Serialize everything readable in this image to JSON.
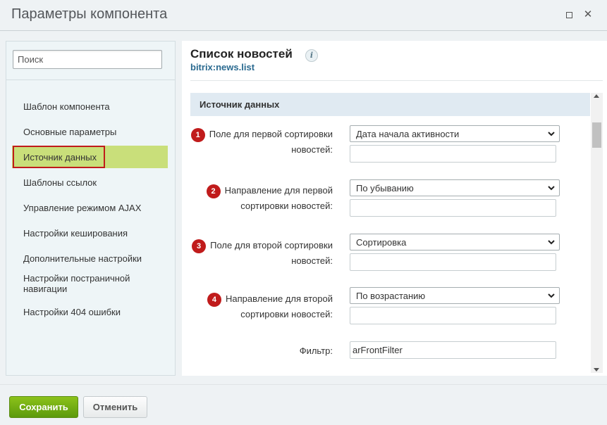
{
  "window": {
    "title": "Параметры компонента"
  },
  "sidebar": {
    "search_placeholder": "Поиск",
    "items": [
      {
        "label": "Шаблон компонента"
      },
      {
        "label": "Основные параметры"
      },
      {
        "label": "Источник данных",
        "active": true
      },
      {
        "label": "Шаблоны ссылок"
      },
      {
        "label": "Управление режимом AJAX"
      },
      {
        "label": "Настройки кеширования"
      },
      {
        "label": "Дополнительные настройки"
      },
      {
        "label": "Настройки постраничной навигации"
      },
      {
        "label": "Настройки 404 ошибки"
      }
    ]
  },
  "component": {
    "title": "Список новостей",
    "code": "bitrix:news.list",
    "info_icon": "i"
  },
  "section": {
    "title": "Источник данных"
  },
  "fields": [
    {
      "badge": "1",
      "label": "Поле для первой сортировки новостей:",
      "value": "Дата начала активности",
      "extra": ""
    },
    {
      "badge": "2",
      "label": "Направление для первой сортировки новостей:",
      "value": "По убыванию",
      "extra": ""
    },
    {
      "badge": "3",
      "label": "Поле для второй сортировки новостей:",
      "value": "Сортировка",
      "extra": ""
    },
    {
      "badge": "4",
      "label": "Направление для второй сортировки новостей:",
      "value": "По возрастанию",
      "extra": ""
    }
  ],
  "filter": {
    "label": "Фильтр:",
    "value": "arFrontFilter"
  },
  "footer": {
    "save_label": "Сохранить",
    "cancel_label": "Отменить"
  },
  "colors": {
    "badge": "#c01b1b",
    "active_item": "#c9df7a",
    "save_button": "#6aa812",
    "link": "#2a6a90"
  }
}
